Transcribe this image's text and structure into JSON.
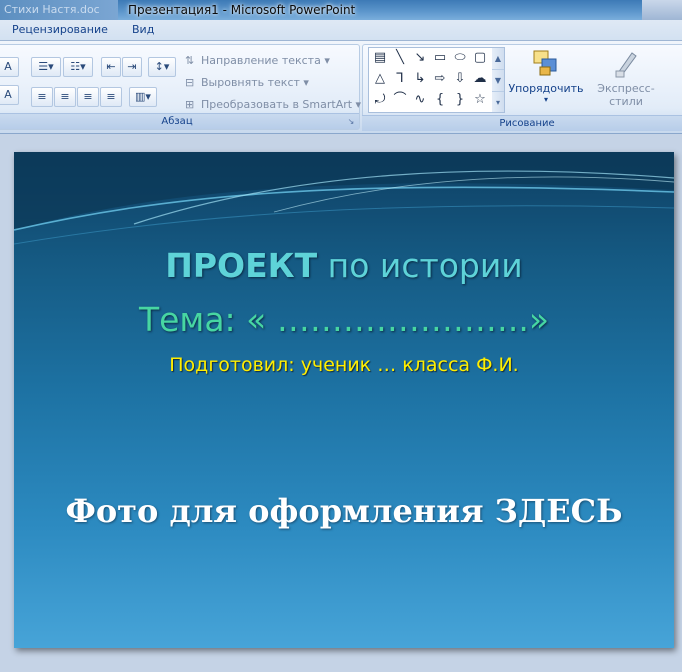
{
  "window": {
    "title": "Презентация1 - Microsoft PowerPoint",
    "blurred_left": "Стихи Настя.doc"
  },
  "tabs": [
    "Рецензирование",
    "Вид"
  ],
  "ribbon": {
    "paragraph": {
      "label": "Абзац",
      "text_direction": "Направление текста",
      "align_text": "Выровнять текст",
      "convert_smartart": "Преобразовать в SmartArt"
    },
    "drawing": {
      "label": "Рисование",
      "arrange": "Упорядочить",
      "quick_styles": "Экспресс-стили"
    }
  },
  "slide": {
    "title_strong": "ПРОЕКТ",
    "title_rest": " по истории",
    "theme_line": "Тема: « …………………..»",
    "author_line": "Подготовил: ученик  … класса Ф.И.",
    "photo_placeholder": "Фото для  оформления ЗДЕСЬ"
  },
  "colors": {
    "title": "#5ed3d8",
    "theme": "#47d6a2",
    "author": "#ffee00",
    "photo_text": "#ffffff"
  }
}
